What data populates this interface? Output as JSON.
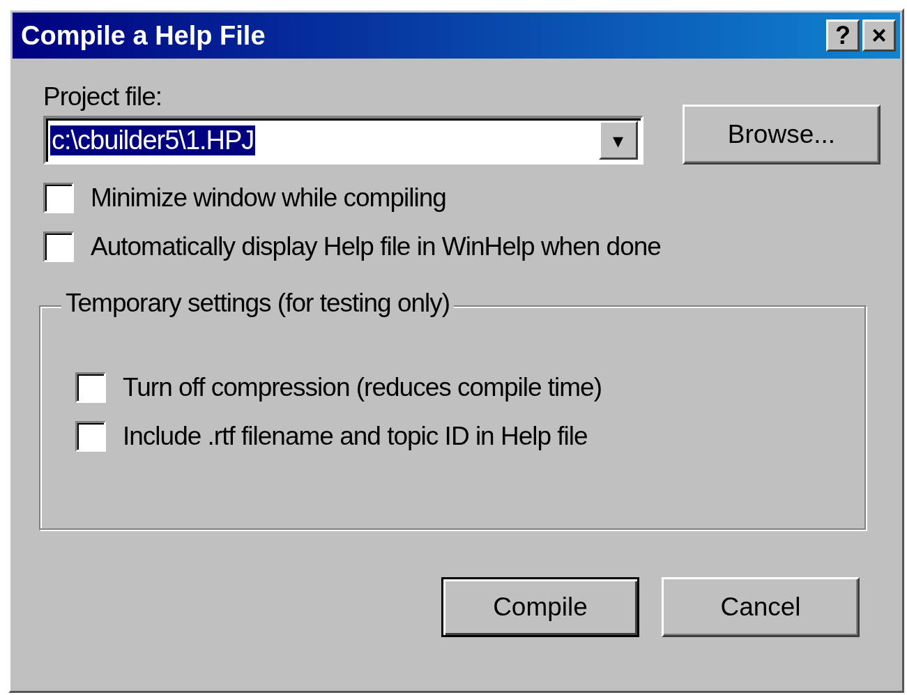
{
  "window": {
    "title": "Compile a Help File",
    "title_buttons": [
      "?",
      "×"
    ]
  },
  "project_file": {
    "label": "Project file:",
    "value": "c:\\cbuilder5\\1.HPJ",
    "highlighted": true,
    "dropdown": "▾"
  },
  "browse_button": "Browse...",
  "options": [
    {
      "label": "Minimize window while compiling",
      "checked": false
    },
    {
      "label": "Automatically display Help file in WinHelp when done",
      "checked": false
    }
  ],
  "temporary_settings": {
    "title": "Temporary settings (for testing only)",
    "options": [
      {
        "label": "Turn off compression (reduces compile time)",
        "checked": false
      },
      {
        "label": "Include .rtf filename and topic ID in Help file",
        "checked": false
      }
    ]
  },
  "buttons": [
    {
      "label": "Compile",
      "default": true
    },
    {
      "label": "Cancel",
      "default": false
    }
  ]
}
